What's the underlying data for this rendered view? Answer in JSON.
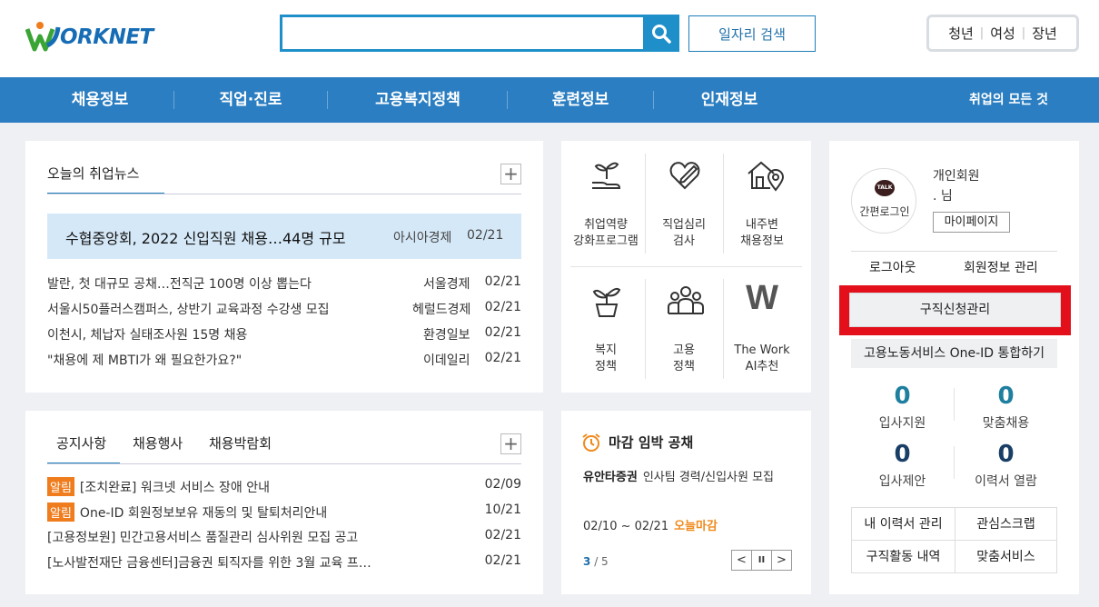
{
  "header": {
    "logo_text": "ORKNET",
    "search_placeholder": "",
    "search_value": "",
    "job_search_label": "일자리 검색",
    "quick_links": [
      "청년",
      "여성",
      "장년"
    ]
  },
  "gnb": {
    "items": [
      "채용정보",
      "직업·진로",
      "고용복지정책",
      "훈련정보",
      "인재정보"
    ],
    "all_label": "취업의 모든 것"
  },
  "news": {
    "tab_label": "오늘의 취업뉴스",
    "more_label": "+",
    "headline": {
      "title": "수협중앙회, 2022 신입직원 채용…44명 규모",
      "source": "아시아경제",
      "date": "02/21"
    },
    "items": [
      {
        "title": "발란, 첫 대규모 공채…전직군 100명 이상 뽑는다",
        "source": "서울경제",
        "date": "02/21"
      },
      {
        "title": "서울시50플러스캠퍼스, 상반기 교육과정 수강생 모집",
        "source": "헤럴드경제",
        "date": "02/21"
      },
      {
        "title": "이천시, 체납자 실태조사원 15명 채용",
        "source": "환경일보",
        "date": "02/21"
      },
      {
        "title": "\"채용에 제 MBTI가 왜 필요한가요?\"",
        "source": "이데일리",
        "date": "02/21"
      }
    ]
  },
  "notice": {
    "tabs": [
      "공지사항",
      "채용행사",
      "채용박람회"
    ],
    "more_label": "+",
    "badge_label": "알림",
    "items": [
      {
        "badge": true,
        "title": "[조치완료] 워크넷 서비스 장애 안내",
        "date": "02/09"
      },
      {
        "badge": true,
        "title": "One-ID 회원정보보유 재동의 및 탈퇴처리안내",
        "date": "10/21"
      },
      {
        "badge": false,
        "title": "[고용정보원] 민간고용서비스 품질관리 심사위원 모집 공고",
        "date": "02/21"
      },
      {
        "badge": false,
        "title": "[노사발전재단 금융센터]금융권 퇴직자를 위한 3월 교육 프…",
        "date": "02/21"
      }
    ]
  },
  "grid": {
    "items": [
      {
        "icon": "seedling-hand-icon",
        "line1": "취업역량",
        "line2": "강화프로그램"
      },
      {
        "icon": "heart-pen-icon",
        "line1": "직업심리",
        "line2": "검사"
      },
      {
        "icon": "house-pin-icon",
        "line1": "내주변",
        "line2": "채용정보"
      },
      {
        "icon": "plant-pot-icon",
        "line1": "복지",
        "line2": "정책"
      },
      {
        "icon": "people-group-icon",
        "line1": "고용",
        "line2": "정책"
      },
      {
        "icon": "the-work-w-icon",
        "line1": "The Work",
        "line2": "AI추천",
        "glyph": "W"
      }
    ]
  },
  "deadline": {
    "title": "마감 임박 공채",
    "company": "유안타증권",
    "desc": "인사팀 경력/신입사원 모집",
    "period": "02/10 ~ 02/21",
    "today_label": "오늘마감",
    "page_current": "3",
    "page_total": "/ 5",
    "prev_label": "<",
    "pause_label": "II",
    "next_label": ">"
  },
  "member": {
    "login_label": "간편로그인",
    "talk_label": "TALK",
    "type": "개인회원",
    "name": ". 님",
    "mypage_label": "마이페이지",
    "logout_label": "로그아웃",
    "info_label": "회원정보 관리",
    "apply_mgr_label": "구직신청관리",
    "oneid_label": "고용노동서비스 One-ID 통합하기",
    "stats": [
      {
        "value": "0",
        "label": "입사지원",
        "color": "#1f7f9f"
      },
      {
        "value": "0",
        "label": "맞춤채용",
        "color": "#1f7f9f"
      },
      {
        "value": "0",
        "label": "입사제안",
        "color": "#1a3f66"
      },
      {
        "value": "0",
        "label": "이력서 열람",
        "color": "#1a3f66"
      }
    ],
    "links": [
      "내 이력서 관리",
      "관심스크랩",
      "구직활동 내역",
      "맞춤서비스"
    ]
  },
  "colors": {
    "brand_blue": "#2b7ec1",
    "accent_orange": "#ef7c1d",
    "highlight_red": "#e30f1a"
  }
}
